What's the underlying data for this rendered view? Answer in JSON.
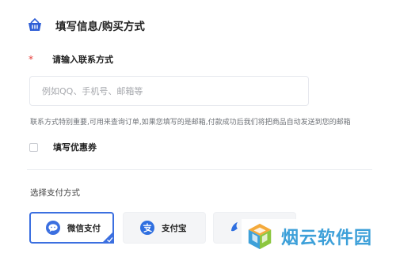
{
  "header": {
    "title": "填写信息/购买方式",
    "icon": "basket-icon"
  },
  "contact": {
    "required_mark": "*",
    "label": "请输入联系方式",
    "value": "",
    "placeholder": "例如QQ、手机号、邮箱等",
    "hint": "联系方式特别重要,可用来查询订单,如果您填写的是邮箱,付款成功后我们将把商品自动发送到您的邮箱"
  },
  "coupon": {
    "label": "填写优惠券",
    "checked": false
  },
  "payment": {
    "section_label": "选择支付方式",
    "options": [
      {
        "label": "微信支付",
        "icon": "wechat-icon",
        "selected": true
      },
      {
        "label": "支付宝",
        "icon": "alipay-icon",
        "selected": false
      },
      {
        "label": "",
        "icon": "third-payment-icon",
        "selected": false
      }
    ]
  },
  "watermark": {
    "text": "烟云软件园"
  },
  "colors": {
    "accent": "#3b6fe0",
    "required": "#e53935",
    "watermark": "#3da0d9"
  }
}
